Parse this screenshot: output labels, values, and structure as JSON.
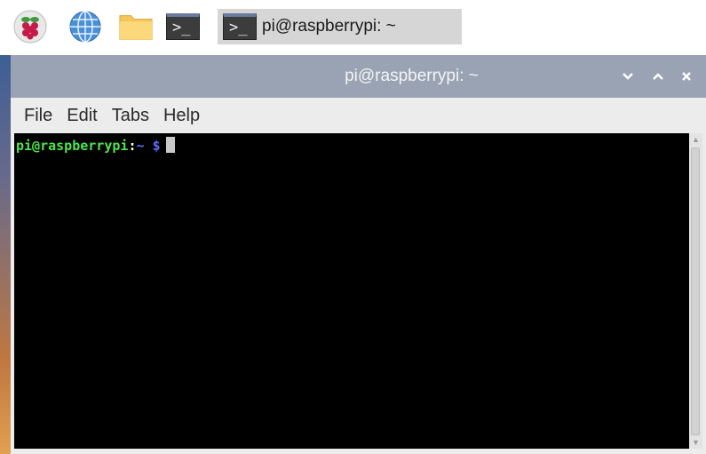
{
  "taskbar": {
    "launchers": [
      {
        "icon": "raspberry-menu-icon"
      },
      {
        "icon": "web-browser-globe-icon"
      },
      {
        "icon": "file-manager-folder-icon"
      },
      {
        "icon": "terminal-icon",
        "glyph": ">_"
      }
    ],
    "active_app": {
      "icon": "terminal-icon",
      "glyph": ">_",
      "label": "pi@raspberrypi: ~"
    }
  },
  "window": {
    "title": "pi@raspberrypi: ~",
    "controls": {
      "minimize": "⌄",
      "maximize": "⌃",
      "close": "✕"
    },
    "menu": [
      "File",
      "Edit",
      "Tabs",
      "Help"
    ],
    "terminal": {
      "user_host": "pi@raspberrypi",
      "colon": ":",
      "path": "~",
      "dollar": "$"
    }
  },
  "colors": {
    "prompt_user": "#4ee44e",
    "prompt_path": "#5a6cff",
    "titlebar": "#9aa3b3",
    "terminal_bg": "#000000"
  }
}
